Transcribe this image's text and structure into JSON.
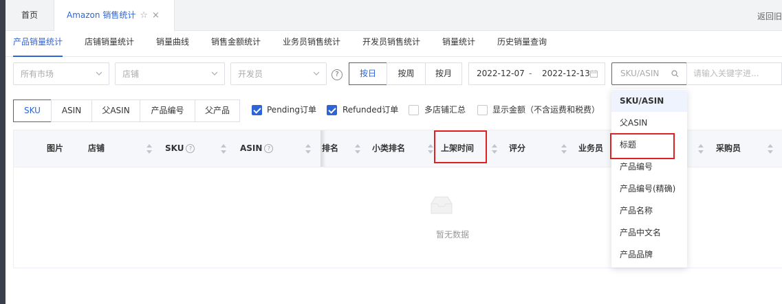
{
  "tabs": {
    "home": "首页",
    "active": "Amazon 销售统计",
    "star": "☆",
    "close": "×",
    "back": "返回旧"
  },
  "subnav": [
    "产品销量统计",
    "店铺销量统计",
    "销量曲线",
    "销售金额统计",
    "业务员销售统计",
    "开发员销售统计",
    "销量统计",
    "历史销量查询"
  ],
  "filters": {
    "market_placeholder": "所有市场",
    "shop_placeholder": "店铺",
    "developer_placeholder": "开发员",
    "help": "?",
    "period": [
      "按日",
      "按周",
      "按月"
    ],
    "date_start": "2022-12-07",
    "date_sep": "-",
    "date_end": "2022-12-13",
    "search_type": "SKU/ASIN",
    "keyword_placeholder": "请输入关键字进..."
  },
  "browse_types": [
    "SKU",
    "ASIN",
    "父ASIN",
    "产品编号",
    "父产品"
  ],
  "checkboxes": [
    {
      "label": "Pending订单",
      "checked": true
    },
    {
      "label": "Refunded订单",
      "checked": true
    },
    {
      "label": "多店铺汇总",
      "checked": false
    },
    {
      "label": "显示金额（不含运费和税费）",
      "checked": false
    }
  ],
  "table": {
    "headers": [
      "图片",
      "店铺",
      "SKU",
      "ASIN",
      "排名",
      "小类排名",
      "上架时间",
      "评分",
      "业务员",
      "采购员"
    ],
    "empty_text": "暂无数据"
  },
  "dropdown": {
    "options": [
      "SKU/ASIN",
      "父ASIN",
      "标题",
      "产品编号",
      "产品编号(精确)",
      "产品名称",
      "产品中文名",
      "产品品牌"
    ],
    "selected": "SKU/ASIN"
  },
  "colors": {
    "accent": "#2d64d6",
    "highlight": "#e02020"
  }
}
